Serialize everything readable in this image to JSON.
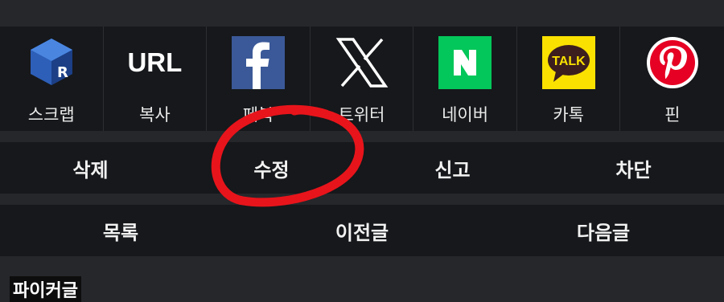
{
  "share": {
    "items": [
      {
        "label": "스크랩",
        "icon": "scrap-cube-icon"
      },
      {
        "label": "복사",
        "icon_text": "URL"
      },
      {
        "label": "페북",
        "icon": "facebook-icon"
      },
      {
        "label": "트위터",
        "icon": "x-twitter-icon"
      },
      {
        "label": "네이버",
        "icon": "naver-icon"
      },
      {
        "label": "카톡",
        "icon": "kakaotalk-icon",
        "icon_text": "TALK"
      },
      {
        "label": "핀",
        "icon": "pinterest-icon"
      }
    ]
  },
  "actions": {
    "delete": "삭제",
    "edit": "수정",
    "report": "신고",
    "block": "차단"
  },
  "nav": {
    "list": "목록",
    "prev": "이전글",
    "next": "다음글"
  },
  "bottom": {
    "title_partial": "파이커글"
  },
  "colors": {
    "background": "#25272b",
    "panel": "#16181b",
    "annotation_red": "#e8141b",
    "facebook": "#3b5998",
    "naver": "#03c75a",
    "kakao": "#fae100",
    "pinterest": "#e60023"
  }
}
